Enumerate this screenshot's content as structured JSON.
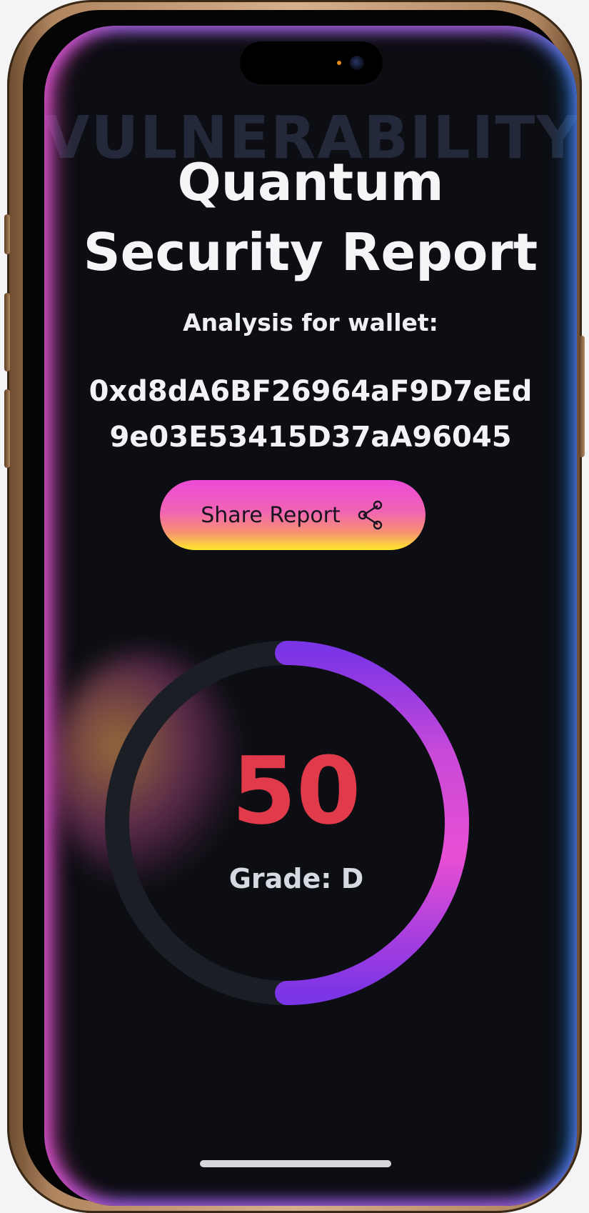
{
  "background_word": "VULNERABILITY",
  "title": {
    "line1": "Quantum",
    "line2": "Security Report"
  },
  "subtitle": "Analysis for wallet:",
  "wallet_address": {
    "line1": "0xd8dA6BF26964aF9D7eEd",
    "line2": "9e03E53415D37aA96045"
  },
  "share_button": {
    "label": "Share Report",
    "icon": "share-icon"
  },
  "score_gauge": {
    "score": "50",
    "max": 100,
    "fraction": 0.5,
    "grade_text": "Grade: D",
    "colors": {
      "score": "#e03a4b",
      "arc_start": "#7b34e6",
      "arc_end": "#e84fd3",
      "track": "#1b1e25"
    }
  }
}
